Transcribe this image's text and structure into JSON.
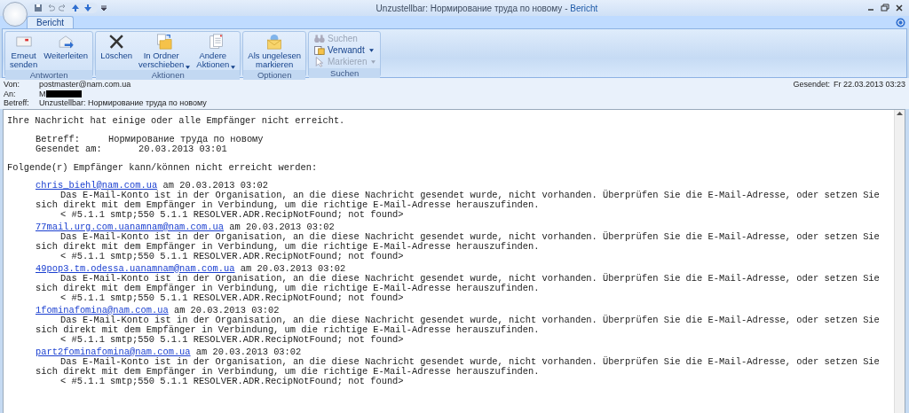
{
  "window": {
    "title": "Unzustellbar: Нормирование труда по новому",
    "separator": "-",
    "app": "Bericht"
  },
  "tabs": [
    {
      "label": "Bericht",
      "selected": true
    }
  ],
  "ribbon": [
    {
      "label": "Antworten",
      "buttons": [
        {
          "kind": "large",
          "label": "Erneut\nsenden",
          "dropdown": false,
          "disabled": false
        },
        {
          "kind": "large",
          "label": "Weiterleiten",
          "dropdown": false,
          "disabled": false
        }
      ]
    },
    {
      "label": "Aktionen",
      "buttons": [
        {
          "kind": "large",
          "label": "Löschen",
          "dropdown": false,
          "disabled": false
        },
        {
          "kind": "large",
          "label": "In Ordner\nverschieben",
          "dropdown": true,
          "disabled": false
        },
        {
          "kind": "large",
          "label": "Andere\nAktionen",
          "dropdown": true,
          "disabled": false
        }
      ]
    },
    {
      "label": "Optionen",
      "buttons": [
        {
          "kind": "large",
          "label": "Als ungelesen\nmarkieren",
          "dropdown": false,
          "disabled": false
        }
      ]
    },
    {
      "label": "Suchen",
      "buttons": [
        {
          "kind": "small",
          "label": "Suchen",
          "dropdown": false,
          "disabled": true
        },
        {
          "kind": "small",
          "label": "Verwandt",
          "dropdown": true,
          "disabled": false
        },
        {
          "kind": "small",
          "label": "Markieren",
          "dropdown": true,
          "disabled": true
        }
      ]
    }
  ],
  "header": {
    "from_label": "Von:",
    "from": "postmaster@nam.com.ua",
    "to_label": "An:",
    "to": "M",
    "subject_label": "Betreff:",
    "subject": "Unzustellbar: Нормирование труда по новому",
    "sent_label": "Gesendet:",
    "sent": "Fr 22.03.2013 03:23"
  },
  "body": {
    "intro": "Ihre Nachricht hat einige oder alle Empfänger nicht erreicht.",
    "subject_label": "Betreff:",
    "subject": "Нормирование труда по новому",
    "sent_label": "Gesendet am:",
    "sent": "20.03.2013 03:01",
    "recipients_intro": "Folgende(r) Empfänger kann/können nicht erreicht werden:",
    "recipients": [
      {
        "address": "chris_biehl@nam.com.ua",
        "when": "am 20.03.2013 03:02",
        "message": "Das E-Mail-Konto ist in der Organisation, an die diese Nachricht gesendet wurde, nicht vorhanden. Überprüfen Sie die E-Mail-Adresse, oder setzen Sie sich direkt mit dem Empfänger in Verbindung, um die richtige E-Mail-Adresse herauszufinden.",
        "code": "< #5.1.1 smtp;550 5.1.1 RESOLVER.ADR.RecipNotFound; not found>"
      },
      {
        "address": "77mail.urg.com.uanamnam@nam.com.ua",
        "when": "am 20.03.2013 03:02",
        "message": "Das E-Mail-Konto ist in der Organisation, an die diese Nachricht gesendet wurde, nicht vorhanden. Überprüfen Sie die E-Mail-Adresse, oder setzen Sie sich direkt mit dem Empfänger in Verbindung, um die richtige E-Mail-Adresse herauszufinden.",
        "code": "< #5.1.1 smtp;550 5.1.1 RESOLVER.ADR.RecipNotFound; not found>"
      },
      {
        "address": "49pop3.tm.odessa.uanamnam@nam.com.ua",
        "when": "am 20.03.2013 03:02",
        "message": "Das E-Mail-Konto ist in der Organisation, an die diese Nachricht gesendet wurde, nicht vorhanden. Überprüfen Sie die E-Mail-Adresse, oder setzen Sie sich direkt mit dem Empfänger in Verbindung, um die richtige E-Mail-Adresse herauszufinden.",
        "code": "< #5.1.1 smtp;550 5.1.1 RESOLVER.ADR.RecipNotFound; not found>"
      },
      {
        "address": "1fominafomina@nam.com.ua",
        "when": "am 20.03.2013 03:02",
        "message": "Das E-Mail-Konto ist in der Organisation, an die diese Nachricht gesendet wurde, nicht vorhanden. Überprüfen Sie die E-Mail-Adresse, oder setzen Sie sich direkt mit dem Empfänger in Verbindung, um die richtige E-Mail-Adresse herauszufinden.",
        "code": "< #5.1.1 smtp;550 5.1.1 RESOLVER.ADR.RecipNotFound; not found>"
      },
      {
        "address": "part2fominafomina@nam.com.ua",
        "when": "am 20.03.2013 03:02",
        "message": "Das E-Mail-Konto ist in der Organisation, an die diese Nachricht gesendet wurde, nicht vorhanden. Überprüfen Sie die E-Mail-Adresse, oder setzen Sie sich direkt mit dem Empfänger in Verbindung, um die richtige E-Mail-Adresse herauszufinden.",
        "code": "< #5.1.1 smtp;550 5.1.1 RESOLVER.ADR.RecipNotFound; not found>"
      }
    ]
  }
}
